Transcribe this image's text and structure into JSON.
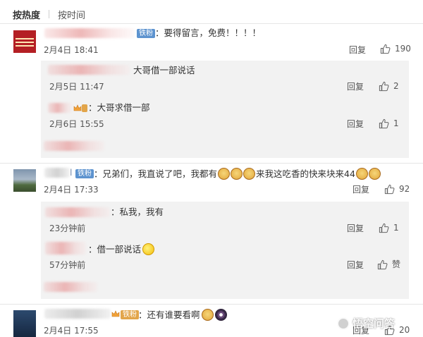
{
  "tabs": {
    "hot": "按热度",
    "time": "按时间"
  },
  "comments": [
    {
      "badge": "铁粉",
      "text": "：要得留言，免费！！！！",
      "date": "2月4日  18:41",
      "reply_label": "回复",
      "likes": "190",
      "replies": [
        {
          "text": "大哥借一部说话",
          "date": "2月5日  11:47",
          "reply_label": "回复",
          "likes": "2"
        },
        {
          "text": "：大哥求借一部",
          "date": "2月6日  15:55",
          "reply_label": "回复",
          "likes": "1"
        }
      ]
    },
    {
      "badge": "铁粉",
      "text_a": "：兄弟们，我直说了吧，我都有",
      "text_b": "来我这吃香的快来块来44",
      "date": "2月4日  17:33",
      "reply_label": "回复",
      "likes": "92",
      "replies": [
        {
          "text": "：私我，我有",
          "date": "23分钟前",
          "reply_label": "回复",
          "likes": "1"
        },
        {
          "text": "：借一部说话",
          "date": "57分钟前",
          "reply_label": "回复",
          "likes": "赞"
        }
      ]
    },
    {
      "badge": "铁粉",
      "text": "：还有谁要看啊",
      "date": "2月4日  17:55",
      "reply_label": "回复",
      "likes": "20"
    }
  ],
  "watermark": "悟空问答",
  "icons": {
    "like": "thumbs-up-icon",
    "crown": "crown-icon",
    "emoji": "cat-face-emoji",
    "smile": "smile-emoji"
  },
  "colors": {
    "badge_blue": "#5d93cf",
    "reply_bg": "#f2f2f2",
    "divider": "#e6e6e6"
  }
}
